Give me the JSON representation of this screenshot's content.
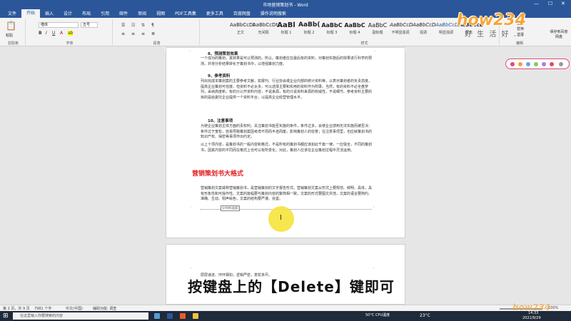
{
  "window": {
    "title": "市场营销策划书 - Word",
    "min": "—",
    "max": "☐",
    "close": "✕"
  },
  "tabs": [
    "文件",
    "开始",
    "插入",
    "设计",
    "布局",
    "引用",
    "邮件",
    "审阅",
    "视图",
    "PDF工具集",
    "更多工具",
    "百度网盘",
    "操作说明搜索"
  ],
  "ribbon": {
    "clipboard_label": "剪贴板",
    "paste_label": "粘贴",
    "font_label": "字体",
    "font_name": "楷体",
    "font_size": "五号",
    "paragraph_label": "段落",
    "styles_label": "样式",
    "styles": [
      {
        "preview": "AaBbCcDt",
        "name": "正文"
      },
      {
        "preview": "AaBbCcDt",
        "name": "无间隔"
      },
      {
        "preview": "AaBl",
        "name": "标题 1"
      },
      {
        "preview": "AaBb(",
        "name": "标题 2"
      },
      {
        "preview": "AaBbC",
        "name": "标题 3"
      },
      {
        "preview": "AaBbC",
        "name": "标题 4"
      },
      {
        "preview": "AaBbC",
        "name": "副标题"
      },
      {
        "preview": "AaBbCcD",
        "name": "不明显强调"
      },
      {
        "preview": "AaBbCcD",
        "name": "强调"
      },
      {
        "preview": "AaBbCcD",
        "name": "明显强调"
      },
      {
        "preview": "AaBbCcD",
        "name": "要点"
      }
    ],
    "find": "查找",
    "replace": "替换",
    "select": "选择",
    "edit_label": "编辑",
    "save_label": "保存到百度网盘"
  },
  "doc": {
    "p8_head": "8、预测策划效果",
    "p8_body": "一个成功的策划，其效果是可以预测的。所以，策划者应在最后有的资料，对策划实施后的效果进行科学的预测，并将分析结果转化于策划书中，以增强策划力度。",
    "p9_head": "9、参考资料",
    "p9_body": "列出完成本策划案的主要参考文献，如报刊、行业协会或企业内部的统计资料等，以表示策划者的负责态度，提高企业策划可信度。但资料不必太多，可以选择主要和实用的资料作为附录。当然，有的资料不必全盘罗列，采纳高度新，有的只公开资料内容，不说来源，有的只说资料来源的权威性，不说细节。参考资料主要的目的是给委托企业提供一个资料平台，以提高企业经营管理水平。",
    "p10_head": "10、注意事项",
    "p10_body": "为使企业策划主体方面的责权利，关注策划书能否实施的条件，条件过多，会使企业感到无法实施而被否决：条件过于宽松，容易导致策划案因考虑不周而半途而废，影响策划人的信誉；在注意事项里，也应就策划书的知识产权、保密等事项作出约定。",
    "p10_body2": "以上十项内容，是策划书的一般内容和格式，不是所有的策划书都应该如此千篇一律，一应俱全，不同的策划书，因其内容的不同而在格式上也可以有所变化，对此，策划人应该在企业策划过程中灵活运用。",
    "section_title": "营销策划书大格式",
    "section_body": "营销策划文案或称营销策划书，是营销策划的文字报告形式。营销策划文案从形式上要规范、鲜明、具体，具有形象性和可操作性。文案的篇幅要与策划内容的繁简相一致，文案的形式要图文并茂，文案的语言要简约、准确、生动、栩声绘色，文案的结构要严谨、完善。",
    "tooltip": "分节符(连续)",
    "page2_line": "层层递进、环环相扣，逻辑严密，意犹未尽。"
  },
  "statusbar": {
    "page": "第 2 页，共 9 页",
    "words": "7981 个字",
    "lang": "中文(中国)",
    "accessibility": "辅助功能: 调查",
    "zoom": "100%"
  },
  "taskbar": {
    "search_placeholder": "在这里输入你要搜索的内容",
    "weather": "23°C",
    "cpu": "50°C CPU温度",
    "time": "14:33",
    "date": "2021/9/29"
  },
  "subtitle": "按键盘上的【Delete】键即可",
  "watermark": {
    "logo": "how234",
    "slogan": "好 生 活 好 ..."
  }
}
